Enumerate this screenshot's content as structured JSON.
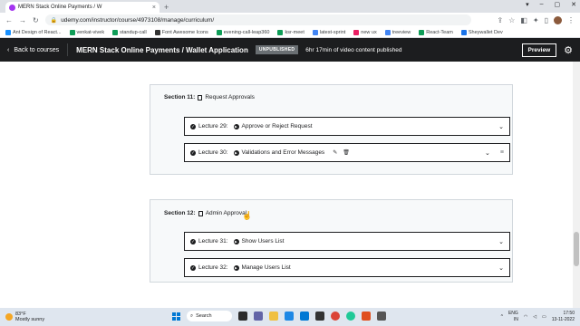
{
  "browser": {
    "tab_title": "MERN Stack Online Payments / W",
    "tab_close": "×",
    "new_tab": "+",
    "window_controls": [
      "▾",
      "–",
      "▢",
      "✕"
    ],
    "url": "udemy.com/instructor/course/4973108/manage/curriculum/",
    "bookmarks": [
      {
        "label": "Ant Design of React...",
        "color": "#1890ff"
      },
      {
        "label": "venkat-vivek",
        "color": "#0f9d58"
      },
      {
        "label": "standup-call",
        "color": "#0f9d58"
      },
      {
        "label": "Font Awesome Icons",
        "color": "#333333"
      },
      {
        "label": "evening-call-leap360",
        "color": "#0f9d58"
      },
      {
        "label": "ksr-meet",
        "color": "#0f9d58"
      },
      {
        "label": "latest-sprint",
        "color": "#4285f4"
      },
      {
        "label": "new ux",
        "color": "#e91e63"
      },
      {
        "label": "treeview",
        "color": "#4285f4"
      },
      {
        "label": "React-Team",
        "color": "#0f9d58"
      },
      {
        "label": "Sheywallet Dev",
        "color": "#1a73e8"
      }
    ]
  },
  "header": {
    "back_label": "Back to courses",
    "course_title": "MERN Stack Online Payments / Wallet Application",
    "status_badge": "UNPUBLISHED",
    "video_info": "6hr 17min of video content published",
    "preview_label": "Preview"
  },
  "sections": [
    {
      "label": "Section 11:",
      "title": "Request Approvals",
      "lectures": [
        {
          "label": "Lecture 29:",
          "title": "Approve or Reject Request"
        },
        {
          "label": "Lecture 30:",
          "title": "Validations and Error Messages"
        }
      ]
    },
    {
      "label": "Section 12:",
      "title": "Admin Approval",
      "lectures": [
        {
          "label": "Lecture 31:",
          "title": "Show Users List"
        },
        {
          "label": "Lecture 32:",
          "title": "Manage Users List"
        }
      ]
    }
  ],
  "taskbar": {
    "weather_temp": "83°F",
    "weather_desc": "Mostly sunny",
    "search_label": "Search",
    "lang_top": "ENG",
    "lang_bottom": "IN",
    "time": "17:50",
    "date": "13-11-2022"
  },
  "colors": {
    "udemy_dark": "#1c1d1f",
    "udemy_purple": "#a435f0",
    "section_bg": "#f7f9fa"
  }
}
